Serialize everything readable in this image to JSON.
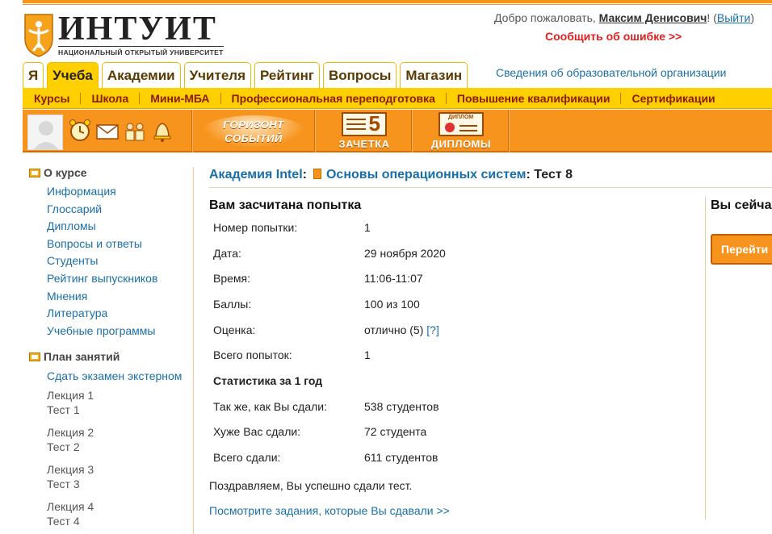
{
  "header": {
    "logo_text": "ИНТУИТ",
    "logo_subtitle": "НАЦИОНАЛЬНЫЙ ОТКРЫТЫЙ УНИВЕРСИТЕТ",
    "welcome_prefix": "Добро пожаловать, ",
    "user_name": "Максим Денисович",
    "welcome_suffix": "! (",
    "logout": "Выйти",
    "close_paren": ")",
    "report_error": "Сообщить об ошибке >>",
    "org_info": "Сведения об образовательной организации"
  },
  "main_tabs": [
    {
      "label": "Я"
    },
    {
      "label": "Учеба",
      "active": true
    },
    {
      "label": "Академии"
    },
    {
      "label": "Учителя"
    },
    {
      "label": "Рейтинг"
    },
    {
      "label": "Вопросы"
    },
    {
      "label": "Магазин"
    }
  ],
  "subnav": [
    "Курсы",
    "Школа",
    "Мини-МБА",
    "Профессиональная переподготовка",
    "Повышение квалификации",
    "Сертификации"
  ],
  "toolbar": {
    "events_label": "ГОРИЗОНТ СОБЫТИЙ",
    "record_label": "ЗАЧЕТКА",
    "record_number": "5",
    "diplomas_label": "ДИПЛОМЫ",
    "diploma_badge": "ДИПЛОМ"
  },
  "sidebar": {
    "about_title": "О курсе",
    "about_links": [
      "Информация",
      "Глоссарий",
      "Дипломы",
      "Вопросы и ответы",
      "Студенты",
      "Рейтинг выпускников",
      "Мнения",
      "Литература",
      "Учебные программы"
    ],
    "plan_title": "План занятий",
    "exam_link": "Сдать экзамен экстерном",
    "lectures": [
      {
        "lecture": "Лекция 1",
        "test": "Тест 1"
      },
      {
        "lecture": "Лекция 2",
        "test": "Тест 2"
      },
      {
        "lecture": "Лекция 3",
        "test": "Тест 3"
      },
      {
        "lecture": "Лекция 4",
        "test": "Тест 4"
      }
    ]
  },
  "breadcrumb": {
    "academy": "Академия Intel",
    "colon1": ":",
    "course": "Основы операционных систем",
    "rest": ": Тест 8"
  },
  "result": {
    "title": "Вам засчитана попытка",
    "rows": [
      {
        "key": "Номер попытки:",
        "value": "1"
      },
      {
        "key": "Дата:",
        "value": "29 ноября 2020"
      },
      {
        "key": "Время:",
        "value": "11:06-11:07"
      },
      {
        "key": "Баллы:",
        "value": "100 из 100"
      },
      {
        "key": "Оценка:",
        "value": "отлично (5)",
        "help": "[?]"
      },
      {
        "key": "Всего попыток:",
        "value": "1"
      }
    ],
    "stats_title": "Статистика за 1 год",
    "stats": [
      {
        "key": "Так же, как Вы сдали:",
        "value": "538 студентов"
      },
      {
        "key": "Хуже Вас сдали:",
        "value": "72 студента"
      },
      {
        "key": "Всего сдали:",
        "value": "611 студентов"
      }
    ],
    "congrats": "Поздравляем, Вы успешно сдали тест.",
    "view_link": "Посмотрите задания, которые Вы сдавали >>"
  },
  "right_panel": {
    "title": "Вы сейча",
    "button": "Перейти"
  },
  "colors": {
    "orange": "#f7941d",
    "yellow": "#ffd000",
    "link": "#1a6fa8",
    "error": "#e02020"
  }
}
